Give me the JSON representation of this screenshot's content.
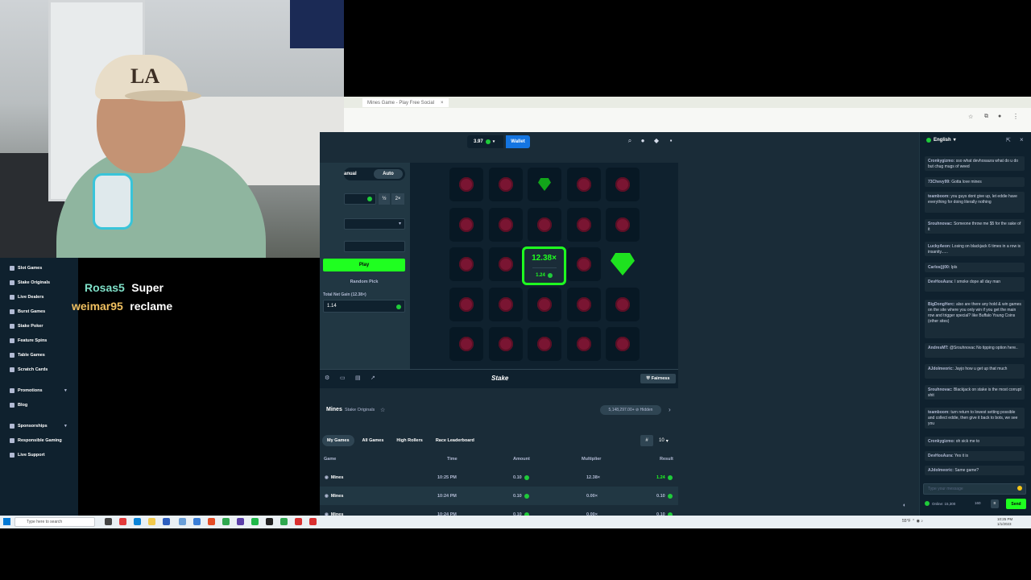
{
  "browser": {
    "tab_title": "Mines Game - Play Free Social"
  },
  "topbar": {
    "balance": "3.97",
    "wallet_label": "Wallet"
  },
  "sidebar": {
    "items": [
      {
        "label": "Slot Games"
      },
      {
        "label": "Stake Originals"
      },
      {
        "label": "Live Dealers"
      },
      {
        "label": "Burst Games"
      },
      {
        "label": "Stake Poker"
      },
      {
        "label": "Feature Spins"
      },
      {
        "label": "Table Games"
      },
      {
        "label": "Scratch Cards"
      },
      {
        "label": "Promotions"
      },
      {
        "label": "Blog"
      },
      {
        "label": "Sponsorships"
      },
      {
        "label": "Responsible Gaming"
      },
      {
        "label": "Live Support"
      }
    ]
  },
  "overlay": {
    "line1_user": "Rosas5",
    "line1_msg": "Super",
    "line2_user": "weimar95",
    "line2_msg": "reclame",
    "user1_color": "#7fe0c8",
    "user2_color": "#f0c060"
  },
  "bet": {
    "manual_label": "anual",
    "auto_label": "Auto",
    "half_label": "½",
    "double_label": "2×",
    "play_label": "Play",
    "random_label": "Random Pick",
    "profit_label": "Total Net Gain (12.38×)",
    "profit_value": "1.14"
  },
  "grid": {
    "rows": [
      [
        "mine",
        "mine",
        "gem",
        "mine",
        "mine"
      ],
      [
        "mine",
        "mine",
        "mine",
        "mine",
        "mine"
      ],
      [
        "mine",
        "mine",
        "win",
        "mine",
        "gem-big"
      ],
      [
        "mine",
        "mine",
        "mine",
        "mine",
        "mine"
      ],
      [
        "mine",
        "mine",
        "mine",
        "mine",
        "mine"
      ]
    ],
    "win_multiplier": "12.38×",
    "win_amount": "1.24"
  },
  "footer": {
    "logo": "Stake",
    "fairness_label": "Fairness"
  },
  "game_info": {
    "title": "Mines",
    "subtitle": "Stake Originals",
    "badge": "5,148,297.00+ ⊘ Hidden"
  },
  "history": {
    "tabs": [
      "My Games",
      "All Games",
      "High Rollers",
      "Race Leaderboard"
    ],
    "page_size": "10",
    "columns": [
      "Game",
      "Time",
      "Amount",
      "Multiplier",
      "Result"
    ],
    "rows": [
      {
        "game": "Mines",
        "time": "10:25 PM",
        "amount": "0.10",
        "multiplier": "12.38×",
        "result": "1.24"
      },
      {
        "game": "Mines",
        "time": "10:24 PM",
        "amount": "0.10",
        "multiplier": "0.00×",
        "result": "0.10"
      },
      {
        "game": "Mines",
        "time": "10:24 PM",
        "amount": "0.10",
        "multiplier": "0.00×",
        "result": "0.10"
      }
    ]
  },
  "chat": {
    "language": "English",
    "messages": [
      {
        "user": "Cronkygizmo:",
        "text": "sso what devhosaura what do u do but chug mugs of weed"
      },
      {
        "user": "73Chevy99:",
        "text": "Gotta love mines"
      },
      {
        "user": "teamboom:",
        "text": "you guys dont give up, let eddie have everything for doing literally nothing"
      },
      {
        "user": "Srouhnovac:",
        "text": "Someone throw me $5 for the sake of it"
      },
      {
        "user": "LuckyAeon:",
        "text": "Losing on blackjack 6 times in a row is insanity......"
      },
      {
        "user": "Carlos(j)00:",
        "text": "lpls"
      },
      {
        "user": "DevHosAura:",
        "text": "I smoke dope all day man"
      },
      {
        "user": "BigDongHerc:",
        "text": "also are there any hold & win games on the site where you only win if you get the main row and trigger special? like Buffalo Young Coins (other sites)"
      },
      {
        "user": "AndresMT:",
        "text": "@Srouhnovac No tipping option here.."
      },
      {
        "user": "AJdolmeoric:",
        "text": "Jayjo how u get up that much"
      },
      {
        "user": "Srouhnovac:",
        "text": "Blackjack on stake is the most corrupt shit"
      },
      {
        "user": "teamboom:",
        "text": "turn return to lowest setting possible and collect eddie, then give it back to bots, we see you"
      },
      {
        "user": "Cronkygizmo:",
        "text": "oh sick me to"
      },
      {
        "user": "DevHosAura:",
        "text": "Yes it is"
      },
      {
        "user": "AJdolmeoric:",
        "text": "Same game?"
      }
    ],
    "input_placeholder": "Type your message",
    "online": "Online: 15,300",
    "char_count": "160",
    "send_label": "Send"
  },
  "taskbar": {
    "search_placeholder": "Type here to search"
  },
  "colors": {
    "accent_green": "#1fff20",
    "bg_main": "#1a2c38",
    "bg_dark": "#0f212e",
    "wallet_blue": "#1475e1"
  }
}
